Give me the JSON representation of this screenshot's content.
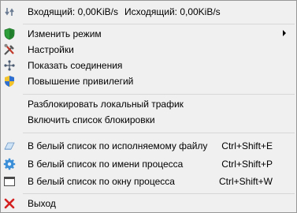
{
  "header": {
    "incoming": "Входящий: 0,00KiB/s",
    "outgoing": "Исходящий: 0,00KiB/s"
  },
  "menu": {
    "change_mode": "Изменить режим",
    "settings": "Настройки",
    "show_connections": "Показать соединения",
    "elevate": "Повышение привилегий",
    "unblock_local": "Разблокировать локальный трафик",
    "enable_blocklist": "Включить список блокировки",
    "whitelist_file": "В белый список по исполняемому файлу",
    "whitelist_file_shortcut": "Ctrl+Shift+E",
    "whitelist_process": "В белый список по имени процесса",
    "whitelist_process_shortcut": "Ctrl+Shift+P",
    "whitelist_window": "В белый список по окну процесса",
    "whitelist_window_shortcut": "Ctrl+Shift+W",
    "exit": "Выход"
  },
  "colors": {
    "menu_bg": "#f0f0f0",
    "separator": "#d7d7d7",
    "shield_green": "#2e9e3a",
    "exit_red": "#d42020"
  }
}
